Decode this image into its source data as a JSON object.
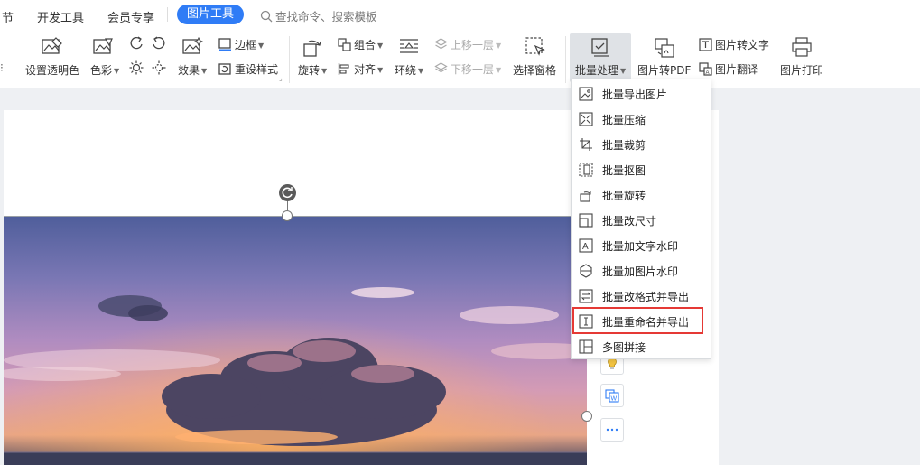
{
  "tabs": {
    "partial_left": "节",
    "dev_tools": "开发工具",
    "member": "会员专享",
    "picture_tools": "图片工具",
    "search_placeholder": "查找命令、搜索模板"
  },
  "ribbon": {
    "set_transparent": "设置透明色",
    "color": "色彩",
    "effect": "效果",
    "border": "边框",
    "reset_style": "重设样式",
    "rotate": "旋转",
    "group": "组合",
    "align": "对齐",
    "wrap": "环绕",
    "bring_forward": "上移一层",
    "send_backward": "下移一层",
    "selection_pane": "选择窗格",
    "batch": "批量处理",
    "pic_to_pdf": "图片转PDF",
    "pic_to_text": "图片转文字",
    "pic_translate": "图片翻译",
    "pic_print": "图片打印"
  },
  "dropdown": {
    "items": [
      "批量导出图片",
      "批量压缩",
      "批量裁剪",
      "批量抠图",
      "批量旋转",
      "批量改尺寸",
      "批量加文字水印",
      "批量加图片水印",
      "批量改格式并导出",
      "批量重命名并导出",
      "多图拼接"
    ],
    "highlighted_index": 9
  },
  "colors": {
    "accent": "#2f7cf6",
    "highlight_border": "#e53935"
  }
}
